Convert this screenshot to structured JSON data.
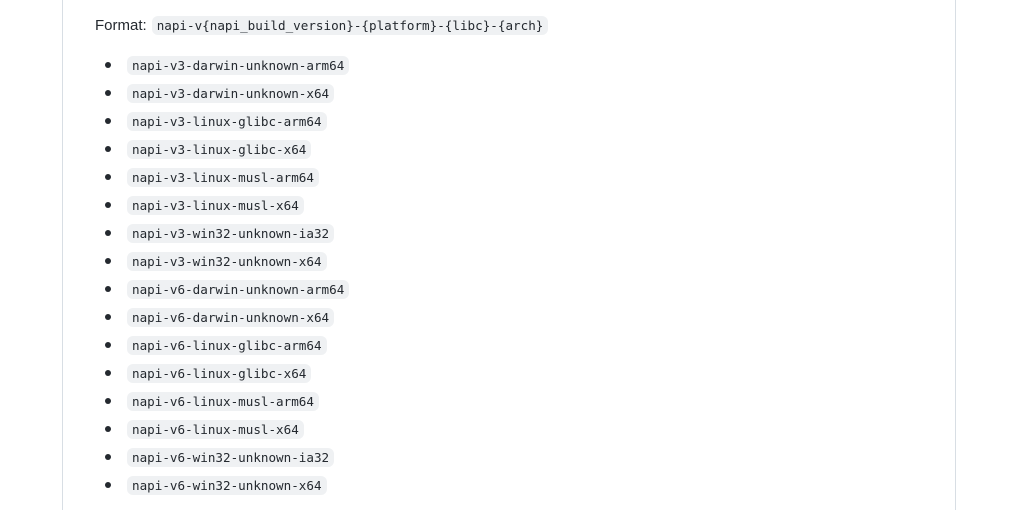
{
  "format": {
    "label": "Format:",
    "pattern": "napi-v{napi_build_version}-{platform}-{libc}-{arch}"
  },
  "targets": [
    "napi-v3-darwin-unknown-arm64",
    "napi-v3-darwin-unknown-x64",
    "napi-v3-linux-glibc-arm64",
    "napi-v3-linux-glibc-x64",
    "napi-v3-linux-musl-arm64",
    "napi-v3-linux-musl-x64",
    "napi-v3-win32-unknown-ia32",
    "napi-v3-win32-unknown-x64",
    "napi-v6-darwin-unknown-arm64",
    "napi-v6-darwin-unknown-x64",
    "napi-v6-linux-glibc-arm64",
    "napi-v6-linux-glibc-x64",
    "napi-v6-linux-musl-arm64",
    "napi-v6-linux-musl-x64",
    "napi-v6-win32-unknown-ia32",
    "napi-v6-win32-unknown-x64"
  ]
}
